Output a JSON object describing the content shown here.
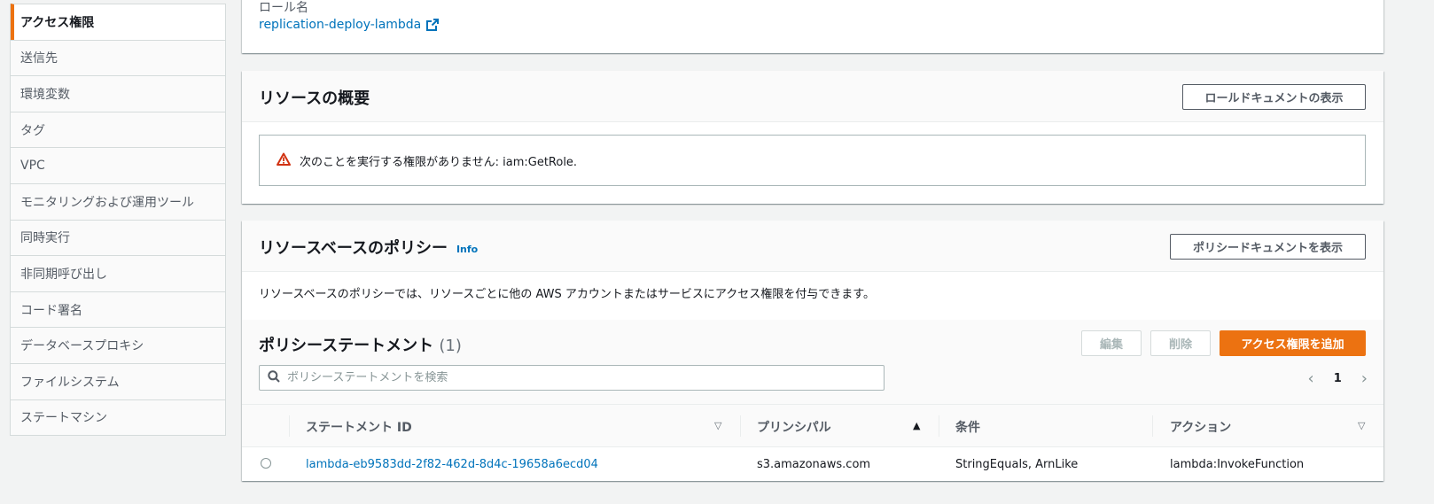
{
  "sidebar": {
    "items": [
      {
        "label": "アクセス権限",
        "active": true
      },
      {
        "label": "送信先"
      },
      {
        "label": "環境変数"
      },
      {
        "label": "タグ"
      },
      {
        "label": "VPC"
      },
      {
        "label": "モニタリングおよび運用ツール"
      },
      {
        "label": "同時実行"
      },
      {
        "label": "非同期呼び出し"
      },
      {
        "label": "コード署名"
      },
      {
        "label": "データベースプロキシ"
      },
      {
        "label": "ファイルシステム"
      },
      {
        "label": "ステートマシン"
      }
    ]
  },
  "role": {
    "label": "ロール名",
    "name": "replication-deploy-lambda"
  },
  "resource_summary": {
    "title": "リソースの概要",
    "view_button": "ロールドキュメントの表示",
    "alert_text": "次のことを実行する権限がありません: iam:GetRole."
  },
  "resource_policy": {
    "title": "リソースベースのポリシー",
    "info": "Info",
    "view_button": "ポリシードキュメントを表示",
    "description": "リソースベースのポリシーでは、リソースごとに他の AWS アカウントまたはサービスにアクセス権限を付与できます。",
    "statements_title": "ポリシーステートメント",
    "statements_count": "(1)",
    "edit_button": "編集",
    "delete_button": "削除",
    "add_button": "アクセス権限を追加",
    "search_placeholder": "ポリシーステートメントを検索",
    "page": "1",
    "columns": [
      "ステートメント ID",
      "プリンシパル",
      "条件",
      "アクション"
    ],
    "rows": [
      {
        "statement_id": "lambda-eb9583dd-2f82-462d-8d4c-19658a6ecd04",
        "principal": "s3.amazonaws.com",
        "condition": "StringEquals, ArnLike",
        "action": "lambda:InvokeFunction"
      }
    ]
  },
  "colors": {
    "accent": "#ec7211",
    "link": "#0073bb",
    "warning": "#d13212"
  },
  "icons": [
    "external-link-icon",
    "warning-icon",
    "search-icon",
    "chevron-left-icon",
    "chevron-right-icon",
    "sort-down-icon",
    "sort-up-icon"
  ]
}
